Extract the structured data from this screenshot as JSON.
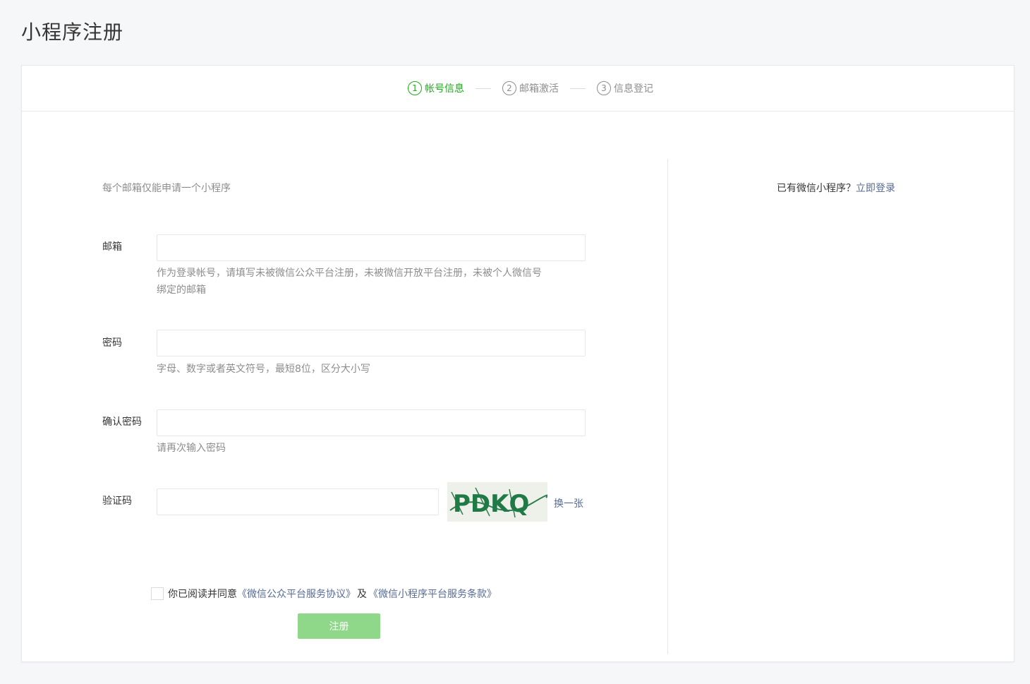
{
  "page": {
    "title": "小程序注册"
  },
  "steps": [
    {
      "num": "1",
      "label": "帐号信息",
      "active": true
    },
    {
      "num": "2",
      "label": "邮箱激活",
      "active": false
    },
    {
      "num": "3",
      "label": "信息登记",
      "active": false
    }
  ],
  "form": {
    "tip": "每个邮箱仅能申请一个小程序",
    "email": {
      "label": "邮箱",
      "value": "",
      "hint_line1": "作为登录帐号，请填写未被微信公众平台注册，未被微信开放平台注册，未被个人微信号",
      "hint_line2": "绑定的邮箱"
    },
    "password": {
      "label": "密码",
      "value": "",
      "hint": "字母、数字或者英文符号，最短8位，区分大小写"
    },
    "confirm": {
      "label": "确认密码",
      "value": "",
      "hint": "请再次输入密码"
    },
    "captcha": {
      "label": "验证码",
      "value": "",
      "image_text": "PDKQ",
      "refresh": "换一张"
    },
    "agreement": {
      "prefix": "你已阅读并同意",
      "link1": "《微信公众平台服务协议》",
      "middle": "及",
      "link2": "《微信小程序平台服务条款》"
    },
    "submit": "注册"
  },
  "side": {
    "text": "已有微信小程序？",
    "link": "立即登录"
  },
  "colors": {
    "brand_green": "#1aad19",
    "disabled_green": "#8fd88a",
    "link_blue": "#576b95"
  }
}
